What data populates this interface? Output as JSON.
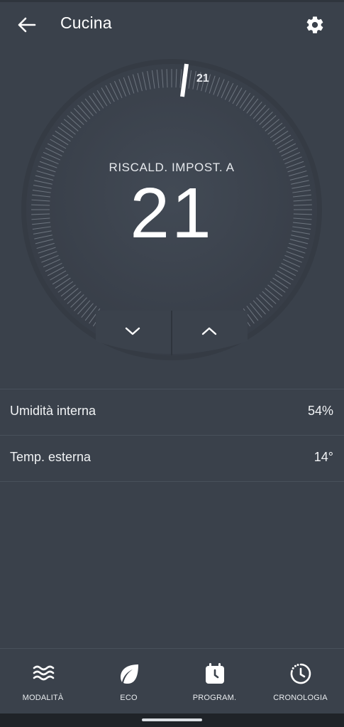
{
  "header": {
    "title": "Cucina",
    "back_icon": "arrow-left-icon",
    "settings_icon": "gear-icon"
  },
  "thermostat": {
    "mode_caption": "RISCALD. IMPOST. A",
    "set_temperature": "21",
    "marker_label": "21",
    "decrease_icon": "chevron-down-icon",
    "increase_icon": "chevron-up-icon"
  },
  "info": [
    {
      "label": "Umidità interna",
      "value": "54%"
    },
    {
      "label": "Temp. esterna",
      "value": "14°"
    }
  ],
  "nav": [
    {
      "label": "MODALITÀ",
      "icon": "waves-icon"
    },
    {
      "label": "ECO",
      "icon": "leaf-icon"
    },
    {
      "label": "PROGRAM.",
      "icon": "calendar-clock-icon"
    },
    {
      "label": "CRONOLOGIA",
      "icon": "history-icon"
    }
  ],
  "colors": {
    "background": "#3a414b",
    "dial_face": "#3e4550",
    "tick": "#8a919b",
    "text": "#ffffff"
  }
}
